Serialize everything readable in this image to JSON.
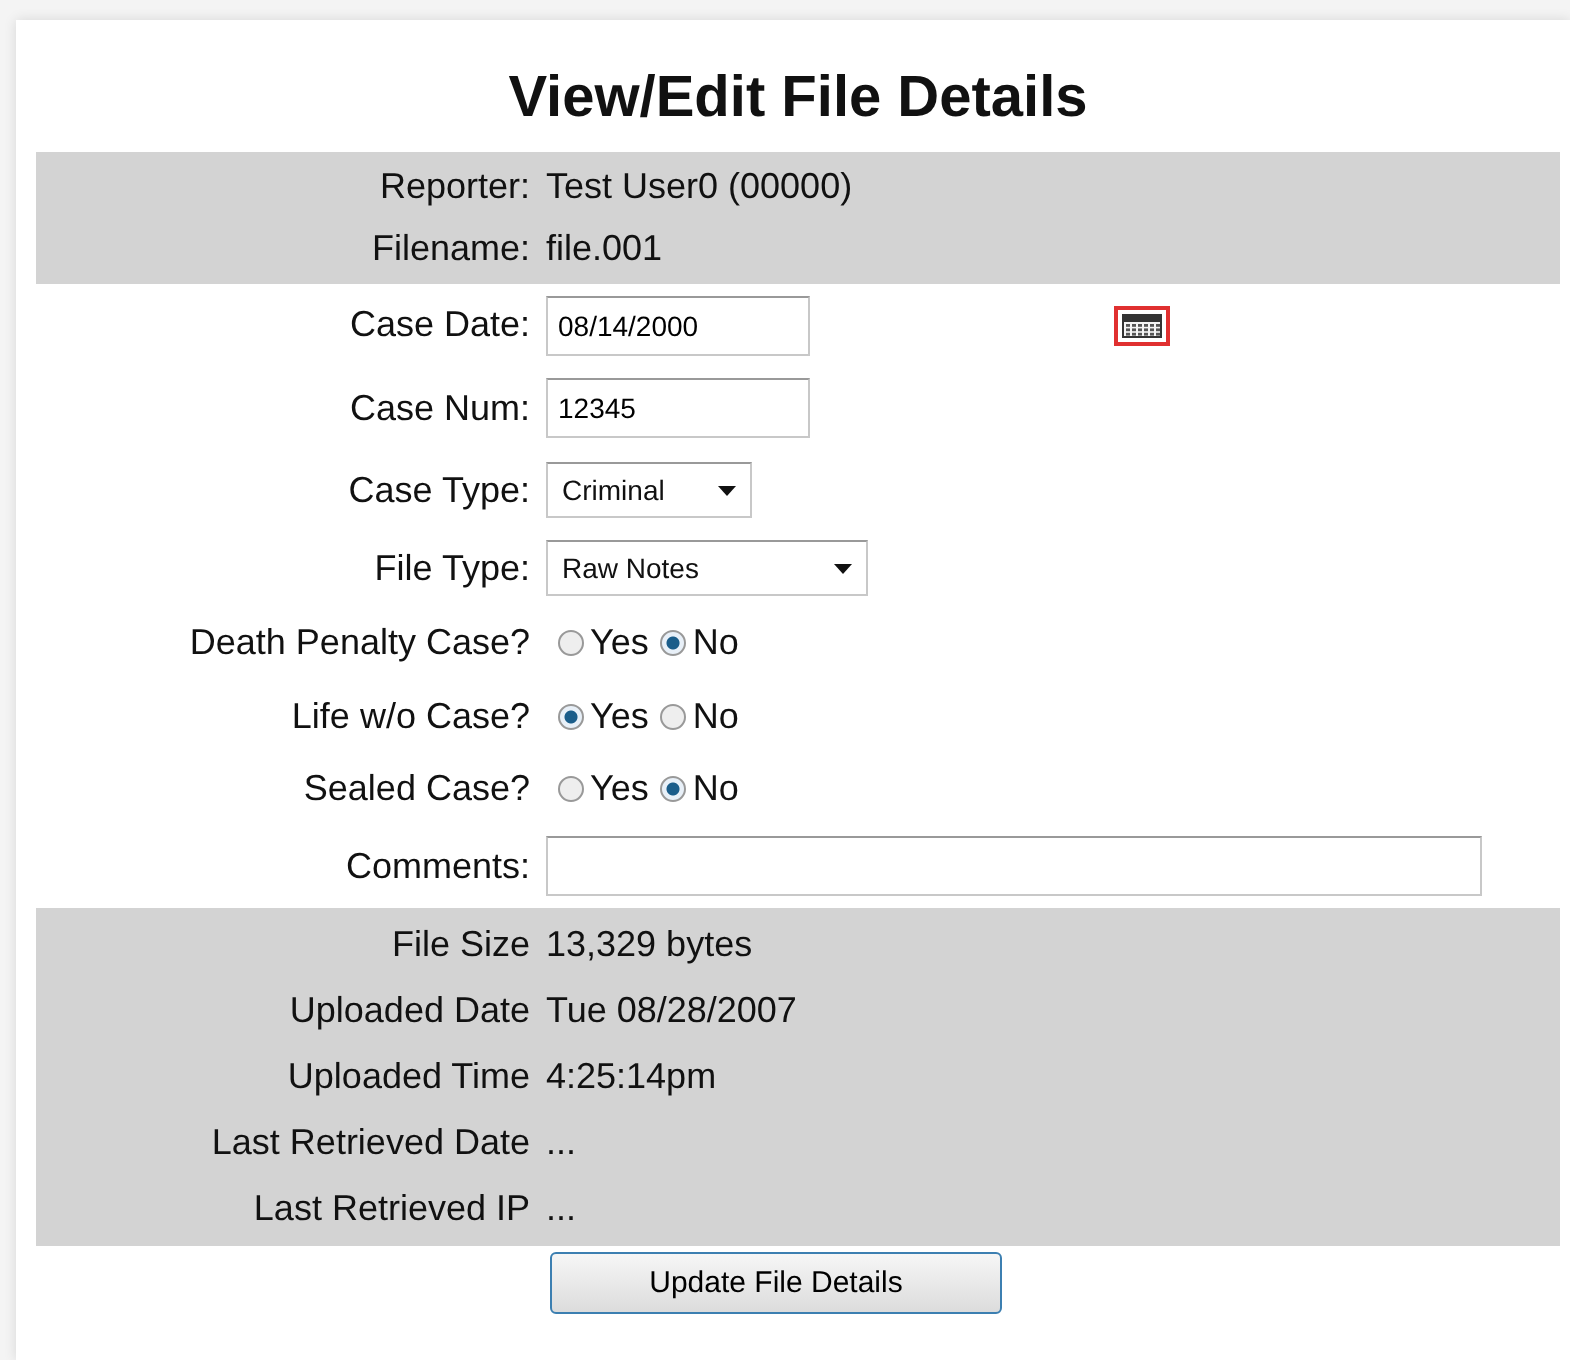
{
  "title": "View/Edit File Details",
  "header_rows": [
    {
      "label": "Reporter:",
      "value": "Test User0 (00000)"
    },
    {
      "label": "Filename:",
      "value": "file.001"
    }
  ],
  "fields": [
    {
      "kind": "date",
      "label": "Case Date:",
      "value": "08/14/2000"
    },
    {
      "kind": "text",
      "label": "Case Num:",
      "value": "12345"
    },
    {
      "kind": "select",
      "label": "Case Type:",
      "value": "Criminal"
    },
    {
      "kind": "wideselect",
      "label": "File Type:",
      "value": "Raw Notes"
    },
    {
      "kind": "radio",
      "label": "Death Penalty Case?",
      "options": [
        {
          "label": "Yes",
          "selected": false
        },
        {
          "label": "No",
          "selected": true
        }
      ]
    },
    {
      "kind": "radio",
      "label": "Life w/o Case?",
      "options": [
        {
          "label": "Yes",
          "selected": true
        },
        {
          "label": "No",
          "selected": false
        }
      ]
    },
    {
      "kind": "radio",
      "label": "Sealed Case?",
      "options": [
        {
          "label": "Yes",
          "selected": false
        },
        {
          "label": "No",
          "selected": true
        }
      ]
    },
    {
      "kind": "wide",
      "label": "Comments:"
    }
  ],
  "info_rows": [
    {
      "label": "File Size",
      "value": "13,329 bytes"
    },
    {
      "label": "Uploaded Date",
      "value": "Tue 08/28/2007"
    },
    {
      "label": "Uploaded Time",
      "value": "4:25:14pm"
    },
    {
      "label": "Last Retrieved Date",
      "value": "..."
    },
    {
      "label": "Last Retrieved IP",
      "value": "..."
    }
  ],
  "submit": "Update File Details"
}
